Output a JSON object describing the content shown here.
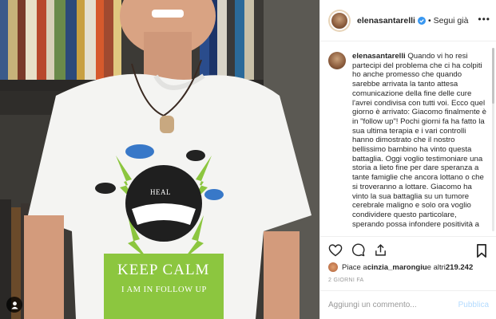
{
  "header": {
    "username": "elenasantarelli",
    "separator": "•",
    "follow_label": "Segui già",
    "more_icon": "more-icon"
  },
  "caption": {
    "username": "elenasantarelli",
    "text": "Quando vi ho resi partecipi del problema che ci ha colpiti ho anche promesso che quando sarebbe arrivata la tanto attesa comunicazione della fine delle cure l'avrei condivisa con tutti voi. Ecco quel giorno è arrivato: Giacomo finalmente è in \"follow up\"! Pochi giorni fa ha fatto la sua ultima terapia e i vari controlli hanno dimostrato che il nostro bellissimo bambino ha vinto questa battaglia. Oggi voglio testimoniare una storia a lieto fine per dare speranza a tante famiglie che ancora lottano o che si troveranno a lottare. Giacomo ha vinto la sua battaglia su un tumore cerebrale maligno e solo ora voglio condividere questo particolare, sperando possa infondere positività a"
  },
  "actions": {
    "like_icon": "heart-icon",
    "comment_icon": "comment-icon",
    "share_icon": "share-icon",
    "save_icon": "bookmark-icon"
  },
  "likes": {
    "prefix": "Piace a ",
    "user": "cinzia_marongiu",
    "middle": " e altri ",
    "count": "219.242"
  },
  "time": "2 GIORNI FA",
  "comment": {
    "placeholder": "Aggiungi un commento...",
    "publish_label": "Pubblica"
  },
  "photo": {
    "shirt_logo": "HEAL",
    "shirt_line1": "KEEP CALM",
    "shirt_line2": "I AM IN FOLLOW UP"
  },
  "colors": {
    "accent_blue": "#3897f0",
    "publish_disabled": "#b3dbff",
    "shirt_green": "#8cc63f"
  }
}
